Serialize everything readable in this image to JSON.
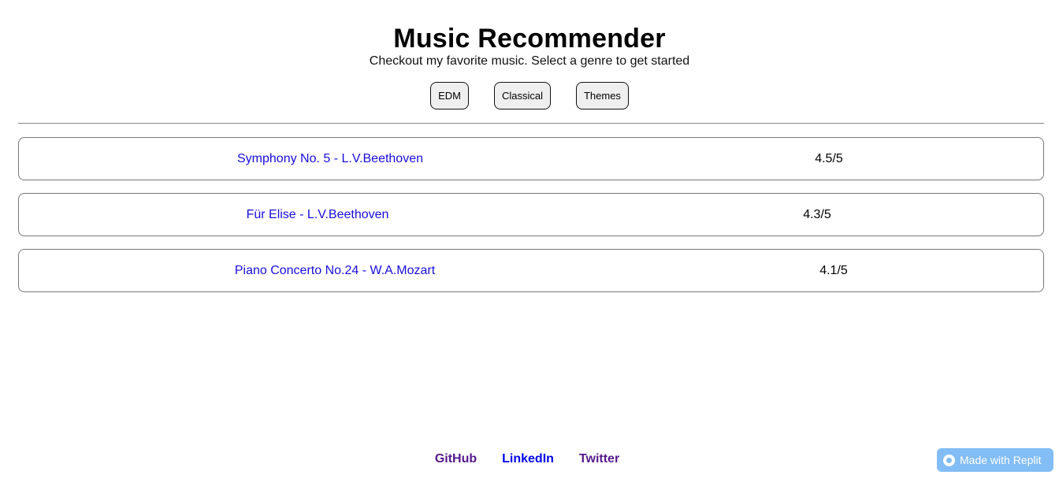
{
  "header": {
    "title": "Music Recommender",
    "subtitle": "Checkout my favorite music. Select a genre to get started"
  },
  "genres": [
    "EDM",
    "Classical",
    "Themes"
  ],
  "songs": [
    {
      "title": "Symphony No. 5 - L.V.Beethoven",
      "rating": "4.5/5"
    },
    {
      "title": "Für Elise - L.V.Beethoven",
      "rating": "4.3/5"
    },
    {
      "title": "Piano Concerto No.24 - W.A.Mozart",
      "rating": "4.1/5"
    }
  ],
  "footer": {
    "links": [
      "GitHub",
      "LinkedIn",
      "Twitter"
    ]
  },
  "badge": {
    "label": "Made with Replit",
    "icon": "replit-icon"
  },
  "colors": {
    "link": "#1a0dd9",
    "visited_link": "#551a8b",
    "badge_bg": "#82bdf5"
  }
}
